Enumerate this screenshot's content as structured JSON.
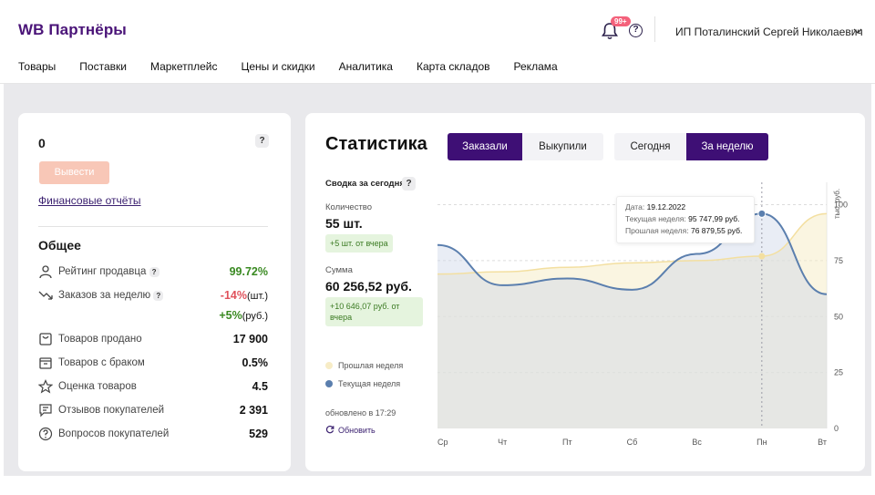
{
  "header": {
    "logo": "WB Партнёры",
    "notifications_badge": "99+",
    "help_symbol": "?",
    "user_name": "ИП Поталинский Сергей Николаевич",
    "nav": [
      "Товары",
      "Поставки",
      "Маркетплейс",
      "Цены и скидки",
      "Аналитика",
      "Карта складов",
      "Реклама"
    ]
  },
  "balance": {
    "value": "0",
    "help": "?",
    "withdraw_label": "Вывести",
    "reports_link": "Финансовые отчёты"
  },
  "general": {
    "title": "Общее",
    "rows": [
      {
        "icon": "user-icon",
        "label": "Рейтинг продавца",
        "help": "?",
        "value": "99.72%"
      },
      {
        "icon": "trend-down-icon",
        "label": "Заказов за неделю",
        "help": "?",
        "value": "-14%",
        "unit": "(шт.)",
        "value2": "+5%",
        "unit2": "(руб.)"
      },
      {
        "icon": "bag-icon",
        "label": "Товаров продано",
        "value": "17 900"
      },
      {
        "icon": "box-icon",
        "label": "Товаров с браком",
        "value": "0.5%"
      },
      {
        "icon": "star-icon",
        "label": "Оценка товаров",
        "value": "4.5"
      },
      {
        "icon": "chat-icon",
        "label": "Отзывов покупателей",
        "value": "2 391"
      },
      {
        "icon": "question-circle-icon",
        "label": "Вопросов покупателей",
        "value": "529"
      }
    ]
  },
  "statistics": {
    "title": "Статистика",
    "tabs_type": [
      "Заказали",
      "Выкупили"
    ],
    "tabs_type_active": 0,
    "tabs_period": [
      "Сегодня",
      "За неделю"
    ],
    "tabs_period_active": 1,
    "summary_title": "Сводка за сегодня",
    "summary_help": "?",
    "quantity_label": "Количество",
    "quantity_value": "55 шт.",
    "quantity_delta": "+5 шт. от вчера",
    "sum_label": "Сумма",
    "sum_value": "60 256,52 руб.",
    "sum_delta": "+10 646,07 руб. от вчера",
    "legend_prev": "Прошлая неделя",
    "legend_curr": "Текущая неделя",
    "updated": "обновлено в 17:29",
    "refresh": "Обновить"
  },
  "tooltip": {
    "date_label": "Дата:",
    "date": "19.12.2022",
    "curr_label": "Текущая неделя:",
    "curr_value": "95 747,99 руб.",
    "prev_label": "Прошлая неделя:",
    "prev_value": "76 879,55 руб."
  },
  "colors": {
    "brand": "#4a1478",
    "tab_active": "#3e0f75",
    "current_week": "#5b7fae",
    "previous_week": "#f5e6b8",
    "positive": "#3a8a22",
    "negative": "#e0525c"
  },
  "chart_data": {
    "type": "area",
    "categories": [
      "Ср",
      "Чт",
      "Пт",
      "Сб",
      "Вс",
      "Пн",
      "Вт"
    ],
    "ylabel": "тыс. руб.",
    "yticks": [
      0,
      25,
      50,
      75,
      100
    ],
    "ylim": [
      0,
      110
    ],
    "grid": "horizontal-dashed",
    "series": [
      {
        "name": "Прошлая неделя",
        "values": [
          69,
          70,
          72,
          74,
          75,
          77,
          96
        ]
      },
      {
        "name": "Текущая неделя",
        "values": [
          82,
          64,
          67,
          62,
          78,
          96,
          60
        ]
      }
    ],
    "highlight_index": 5
  }
}
